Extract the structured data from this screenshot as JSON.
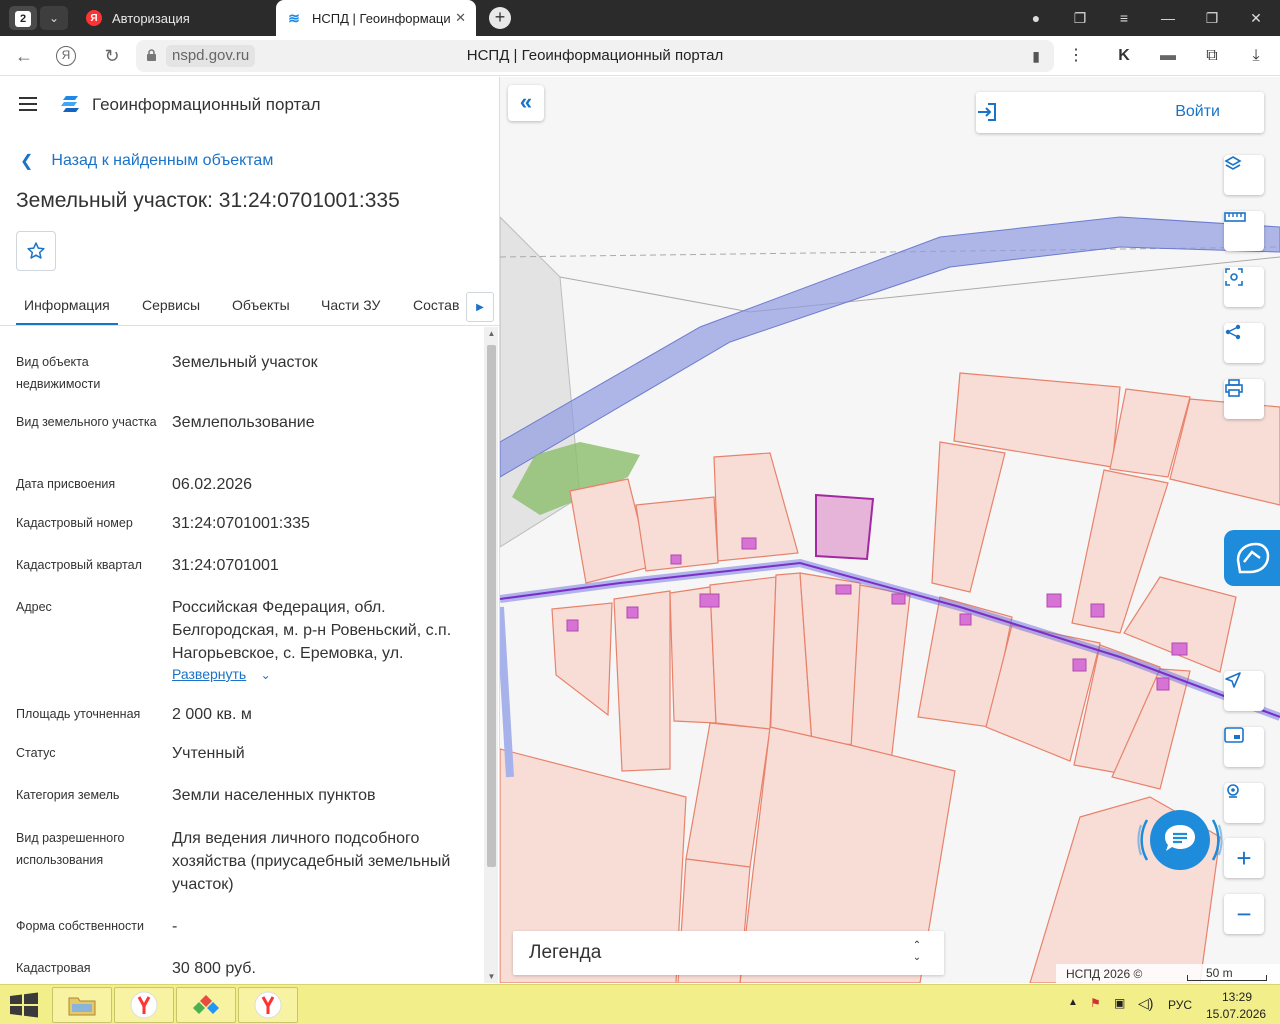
{
  "browser": {
    "tab_count": "2",
    "tabs": [
      {
        "title": "Авторизация",
        "active": false
      },
      {
        "title": "НСПД | Геоинформаци",
        "active": true
      }
    ],
    "url_host": "nspd.gov.ru",
    "page_title": "НСПД | Геоинформационный портал"
  },
  "header": {
    "portal_title": "Геоинформационный портал"
  },
  "panel": {
    "back_label": "Назад к найденным объектам",
    "object_title": "Земельный участок: 31:24:0701001:335",
    "tabs": [
      "Информация",
      "Сервисы",
      "Объекты",
      "Части ЗУ",
      "Состав"
    ],
    "properties": [
      {
        "label": "Вид объекта недвижимости",
        "value": "Земельный участок"
      },
      {
        "label": "Вид земельного участка",
        "value": "Землепользование"
      },
      {
        "label": "Дата присвоения",
        "value": "06.02.2026"
      },
      {
        "label": "Кадастровый номер",
        "value": "31:24:0701001:335"
      },
      {
        "label": "Кадастровый квартал",
        "value": "31:24:0701001"
      },
      {
        "label": "Адрес",
        "value": "Российская Федерация, обл. Белгородская, м. р-н Ровеньский, с.п. Нагорьевское, с. Еремовка, ул."
      },
      {
        "label": "Площадь уточненная",
        "value": "2 000 кв. м"
      },
      {
        "label": "Статус",
        "value": "Учтенный"
      },
      {
        "label": "Категория земель",
        "value": "Земли населенных пунктов"
      },
      {
        "label": "Вид разрешенного использования",
        "value": "Для ведения личного подсобного хозяйства (приусадебный земельный участок)"
      },
      {
        "label": "Форма собственности",
        "value": "-"
      },
      {
        "label": "Кадастровая",
        "value": "30 800 руб."
      }
    ],
    "expand_label": "Развернуть"
  },
  "map": {
    "login_label": "Войти",
    "legend_label": "Легенда",
    "copyright": "НСПД 2026 ©",
    "scale": "50 m",
    "colors": {
      "parcel_fill": "#f7ddd6",
      "parcel_stroke": "#e8826b",
      "selected_fill": "#e6b3d9",
      "selected_stroke": "#a22aa0",
      "road_band": "#8f9be0",
      "green": "#8bbd6a",
      "accent": "#1a73c8"
    }
  },
  "taskbar": {
    "lang": "РУС",
    "time": "13:29",
    "date": "15.07.2026"
  }
}
